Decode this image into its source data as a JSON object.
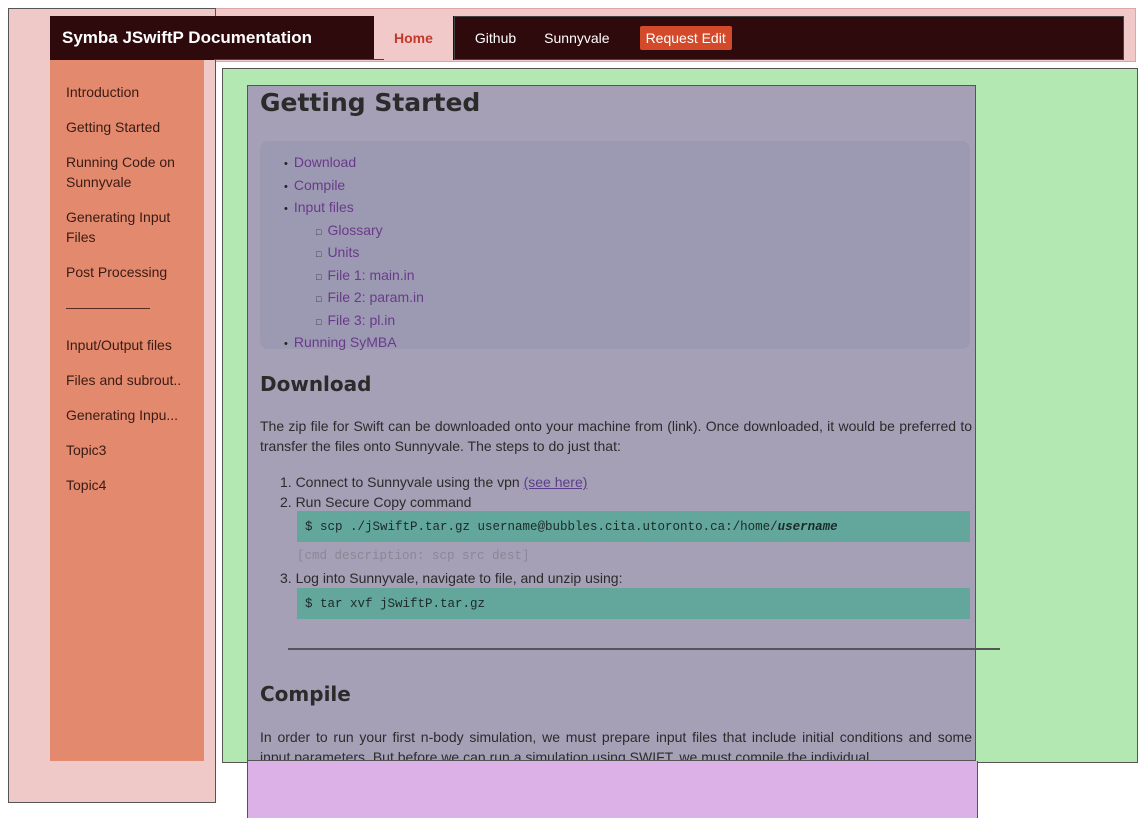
{
  "navbar": {
    "brand": "Symba JSwiftP Documentation",
    "links": [
      "Home",
      "Github",
      "Sunnyvale"
    ],
    "request_edit": "Request Edit"
  },
  "sidebar": {
    "items_top": [
      "Introduction",
      "Getting Started",
      "Running Code on Sunnyvale",
      "Generating Input Files",
      "Post Processing"
    ],
    "items_bottom": [
      "Input/Output files",
      "Files and subrout..",
      "Generating Inpu...",
      "Topic3",
      "Topic4"
    ]
  },
  "main": {
    "title": "Getting Started",
    "toc": {
      "download": "Download",
      "compile": "Compile",
      "input_files": "Input files",
      "sub": [
        "Glossary",
        "Units",
        "File 1: main.in",
        "File 2: param.in",
        "File 3: pl.in"
      ],
      "running": "Running SyMBA"
    },
    "download": {
      "heading": "Download",
      "intro": "The zip file for Swift can be downloaded onto your machine from (link). Once downloaded, it would be preferred to transfer the files onto Sunnyvale. The steps to do just that:",
      "step1_text": "1. Connect to Sunnyvale using the vpn ",
      "step1_link": "(see here)",
      "step2": "2. Run Secure Copy command",
      "code1_prefix": "$ scp ./jSwiftP.tar.gz username@bubbles.cita.utoronto.ca:/home/",
      "code1_user": "username",
      "cmd_desc": "[cmd description: scp src dest]",
      "step3": "3. Log into Sunnyvale, navigate to file, and unzip using:",
      "code2": "$ tar xvf jSwiftP.tar.gz"
    },
    "compile": {
      "heading": "Compile",
      "text": "In order to run your first n-body simulation, we must prepare input files that include initial conditions and some input parameters. But before we can run a simulation using SWIFT, we must compile the individual"
    }
  }
}
